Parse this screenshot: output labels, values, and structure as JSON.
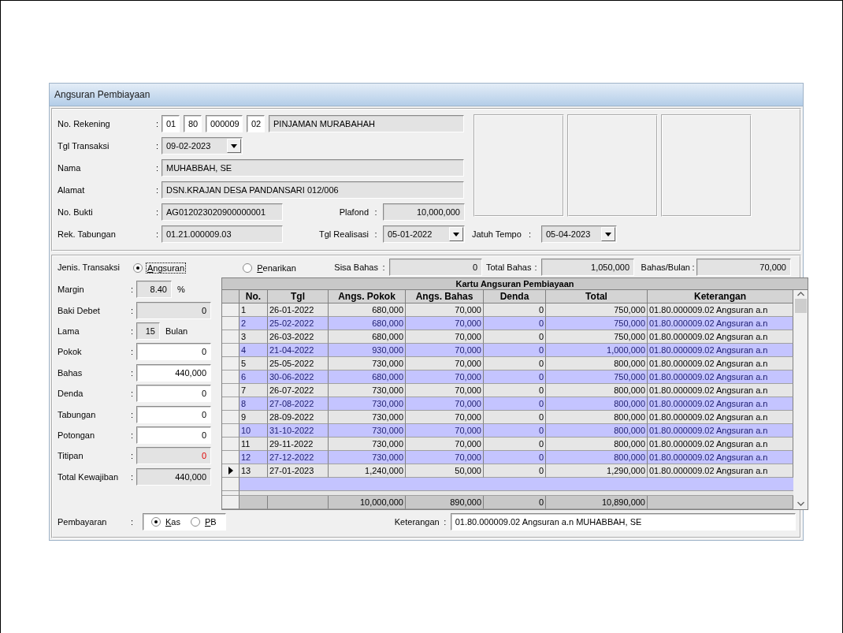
{
  "window": {
    "title": "Angsuran Pembiayaan"
  },
  "header": {
    "no_rekening": {
      "label": "No. Rekening",
      "sep": ":",
      "parts": [
        "01",
        "80",
        "000009",
        "02"
      ],
      "product": "PINJAMAN MURABAHAH"
    },
    "tgl_transaksi": {
      "label": "Tgl Transaksi",
      "sep": ":",
      "value": "09-02-2023"
    },
    "nama": {
      "label": "Nama",
      "sep": ":",
      "value": "MUHABBAH, SE"
    },
    "alamat": {
      "label": "Alamat",
      "sep": ":",
      "value": "DSN.KRAJAN DESA PANDANSARI 012/006"
    },
    "no_bukti": {
      "label": "No. Bukti",
      "sep": ":",
      "value": "AG012023020900000001"
    },
    "plafond": {
      "label": "Plafond",
      "sep": ":",
      "value": "10,000,000"
    },
    "rek_tabungan": {
      "label": "Rek. Tabungan",
      "sep": ":",
      "value": "01.21.000009.03"
    },
    "tgl_realisasi": {
      "label": "Tgl Realisasi",
      "sep": ":",
      "value": "05-01-2022"
    },
    "jatuh_tempo": {
      "label": "Jatuh Tempo",
      "sep": ":",
      "value": "05-04-2023"
    }
  },
  "transaction_type": {
    "label": "Jenis. Transaksi",
    "options": [
      {
        "label": "Angsuran",
        "selected": true,
        "focused": true
      },
      {
        "label": "Penarikan",
        "selected": false,
        "focused": false
      }
    ]
  },
  "summary": [
    {
      "label": "Sisa Bahas",
      "sep": ":",
      "value": "0"
    },
    {
      "label": "Total Bahas",
      "sep": ":",
      "value": "1,050,000"
    },
    {
      "label": "Bahas/Bulan",
      "sep": ":",
      "value": "70,000"
    }
  ],
  "left_fields": [
    {
      "kind": "short",
      "label": "Margin",
      "sep": ":",
      "value": "8.40",
      "suffix": "%",
      "editable": false,
      "alert": false
    },
    {
      "kind": "full",
      "label": "Baki Debet",
      "sep": ":",
      "value": "0",
      "editable": false,
      "alert": false
    },
    {
      "kind": "tiny",
      "label": "Lama",
      "sep": ":",
      "value": "15",
      "suffix": "Bulan",
      "editable": false,
      "alert": false
    },
    {
      "kind": "full",
      "label": "Pokok",
      "sep": ":",
      "value": "0",
      "editable": true,
      "alert": false
    },
    {
      "kind": "full",
      "label": "Bahas",
      "sep": ":",
      "value": "440,000",
      "editable": true,
      "alert": false
    },
    {
      "kind": "full",
      "label": "Denda",
      "sep": ":",
      "value": "0",
      "editable": true,
      "alert": false
    },
    {
      "kind": "full",
      "label": "Tabungan",
      "sep": ":",
      "value": "0",
      "editable": true,
      "alert": false
    },
    {
      "kind": "full",
      "label": "Potongan",
      "sep": ":",
      "value": "0",
      "editable": true,
      "alert": false
    },
    {
      "kind": "full",
      "label": "Titipan",
      "sep": ":",
      "value": "0",
      "editable": false,
      "alert": true
    },
    {
      "kind": "full",
      "label": "Total Kewajiban",
      "sep": ":",
      "value": "440,000",
      "editable": false,
      "alert": false
    }
  ],
  "grid": {
    "title": "Kartu Angsuran Pembiayaan",
    "columns": [
      "No.",
      "Tgl",
      "Angs. Pokok",
      "Angs. Bahas",
      "Denda",
      "Total",
      "Keterangan"
    ],
    "rows": [
      {
        "cells": [
          "1",
          "26-01-2022",
          "680,000",
          "70,000",
          "0",
          "750,000",
          "01.80.000009.02 Angsuran a.n"
        ],
        "current": false
      },
      {
        "cells": [
          "2",
          "25-02-2022",
          "680,000",
          "70,000",
          "0",
          "750,000",
          "01.80.000009.02 Angsuran a.n"
        ],
        "current": false
      },
      {
        "cells": [
          "3",
          "26-03-2022",
          "680,000",
          "70,000",
          "0",
          "750,000",
          "01.80.000009.02 Angsuran a.n"
        ],
        "current": false
      },
      {
        "cells": [
          "4",
          "21-04-2022",
          "930,000",
          "70,000",
          "0",
          "1,000,000",
          "01.80.000009.02 Angsuran a.n"
        ],
        "current": false
      },
      {
        "cells": [
          "5",
          "25-05-2022",
          "730,000",
          "70,000",
          "0",
          "800,000",
          "01.80.000009.02 Angsuran a.n"
        ],
        "current": false
      },
      {
        "cells": [
          "6",
          "30-06-2022",
          "680,000",
          "70,000",
          "0",
          "750,000",
          "01.80.000009.02 Angsuran a.n"
        ],
        "current": false
      },
      {
        "cells": [
          "7",
          "26-07-2022",
          "730,000",
          "70,000",
          "0",
          "800,000",
          "01.80.000009.02 Angsuran a.n"
        ],
        "current": false
      },
      {
        "cells": [
          "8",
          "27-08-2022",
          "730,000",
          "70,000",
          "0",
          "800,000",
          "01.80.000009.02 Angsuran a.n"
        ],
        "current": false
      },
      {
        "cells": [
          "9",
          "28-09-2022",
          "730,000",
          "70,000",
          "0",
          "800,000",
          "01.80.000009.02 Angsuran a.n"
        ],
        "current": false
      },
      {
        "cells": [
          "10",
          "31-10-2022",
          "730,000",
          "70,000",
          "0",
          "800,000",
          "01.80.000009.02 Angsuran a.n"
        ],
        "current": false
      },
      {
        "cells": [
          "11",
          "29-11-2022",
          "730,000",
          "70,000",
          "0",
          "800,000",
          "01.80.000009.02 Angsuran a.n"
        ],
        "current": false
      },
      {
        "cells": [
          "12",
          "27-12-2022",
          "730,000",
          "70,000",
          "0",
          "800,000",
          "01.80.000009.02 Angsuran a.n"
        ],
        "current": false
      },
      {
        "cells": [
          "13",
          "27-01-2023",
          "1,240,000",
          "50,000",
          "0",
          "1,290,000",
          "01.80.000009.02 Angsuran a.n"
        ],
        "current": true
      }
    ],
    "totals": {
      "angs_pokok": "10,000,000",
      "angs_bahas": "890,000",
      "denda": "0",
      "total": "10,890,000"
    }
  },
  "payment": {
    "label": "Pembayaran",
    "sep": ":",
    "options": [
      {
        "label": "Kas",
        "selected": true
      },
      {
        "label": "PB",
        "selected": false
      }
    ]
  },
  "keterangan": {
    "label": "Keterangan",
    "sep": ":",
    "value": "01.80.000009.02 Angsuran a.n MUHABBAH, SE"
  }
}
